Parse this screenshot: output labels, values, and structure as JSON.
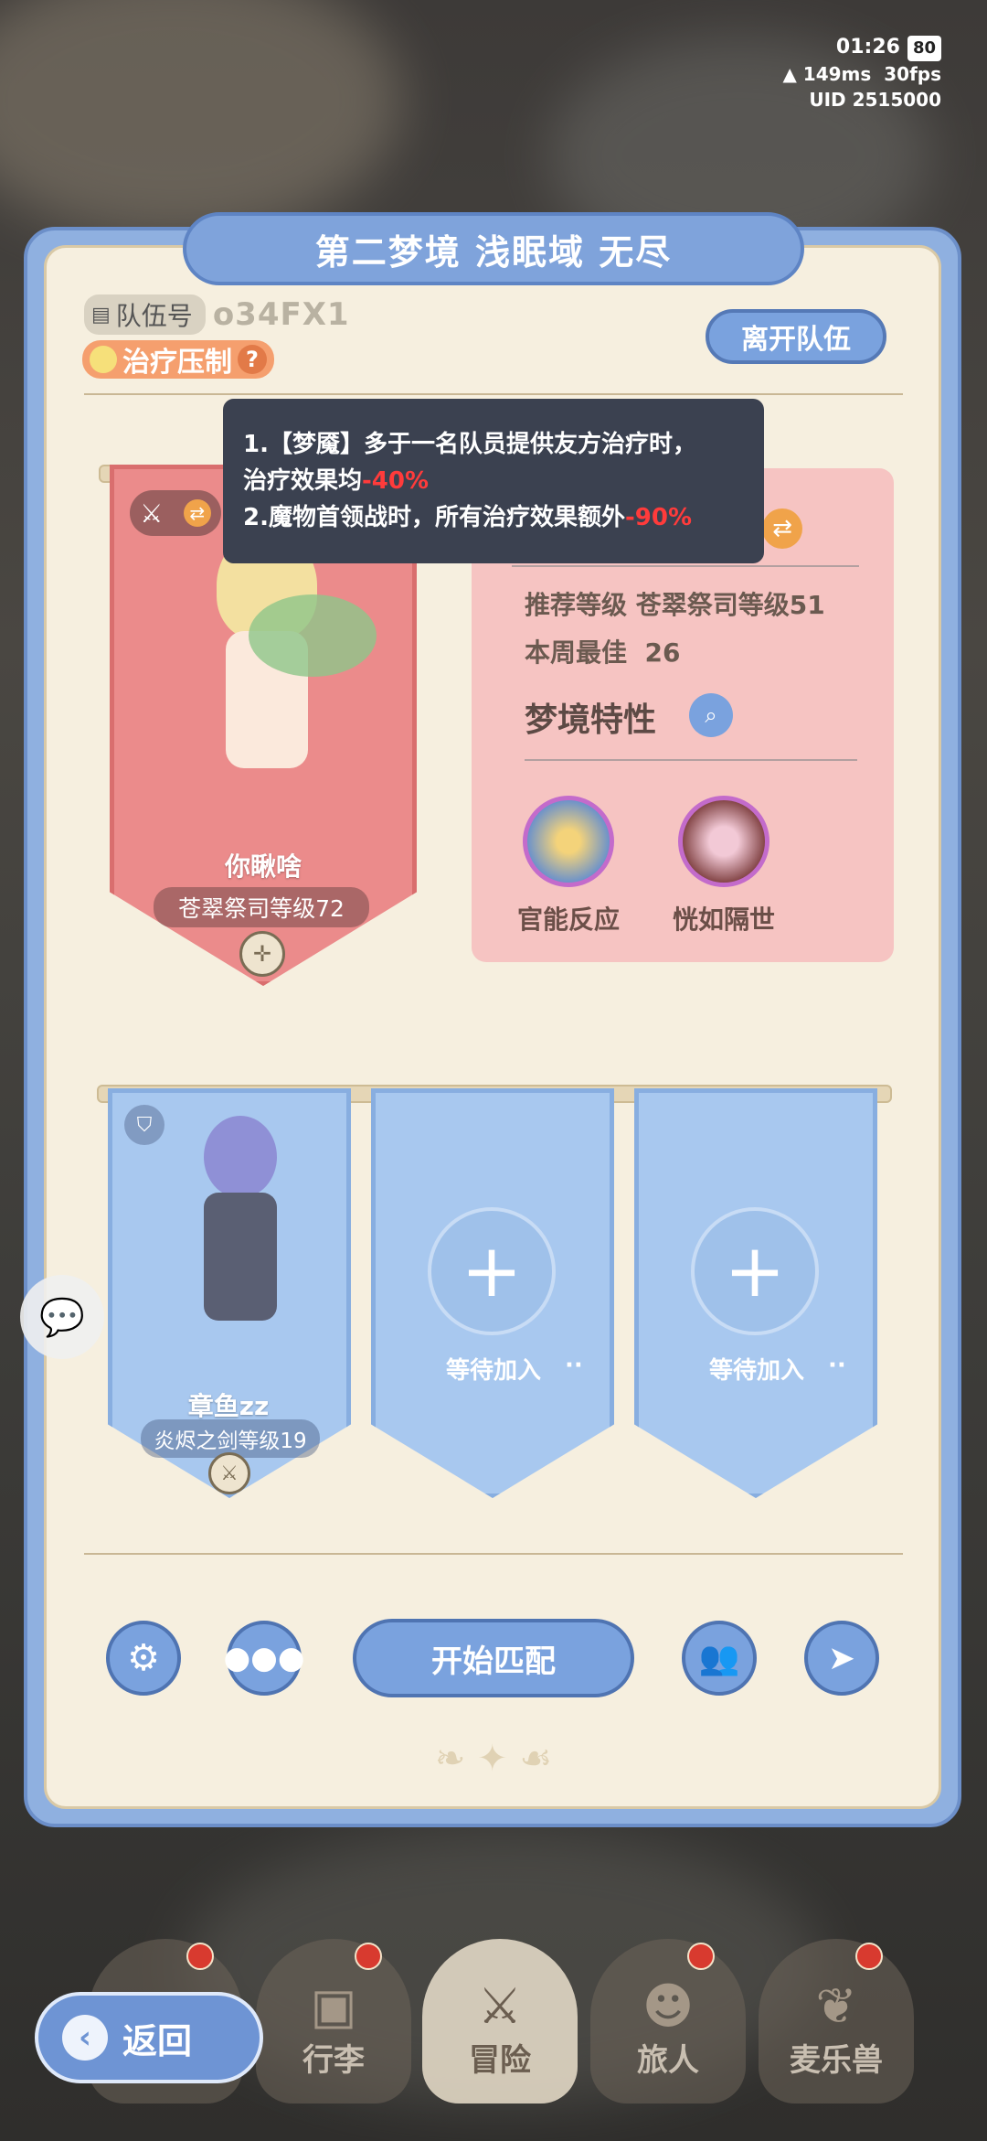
{
  "status": {
    "time": "01:26",
    "battery": "80",
    "ping": "149ms",
    "fps": "30fps",
    "uid": "UID  2515000"
  },
  "title": "第二梦境 浅眠域 无尽",
  "team": {
    "id_label": "队伍号",
    "id_value": "o34FX1",
    "heal_chip": "治疗压制",
    "leave_label": "离开队伍"
  },
  "tooltip": {
    "line1": "1.【梦魇】多于一名队员提供友方治疗时，",
    "line2_prefix": "治疗效果均",
    "line2_value": "-40%",
    "line3_prefix": "2.魔物首领战时，所有治疗效果额外",
    "line3_value": "-90%"
  },
  "leader": {
    "name": "你瞅啥",
    "level": "苍翠祭司等级72"
  },
  "info": {
    "recommend_label": "推荐等级",
    "recommend_value": "苍翠祭司等级51",
    "best_label": "本周最佳",
    "best_value": "26",
    "traits_title": "梦境特性",
    "traits": [
      {
        "label": "官能反应"
      },
      {
        "label": "恍如隔世"
      }
    ]
  },
  "members": [
    {
      "name": "章鱼zz",
      "level": "炎烬之剑等级19"
    },
    {
      "wait": "等待加入",
      "ellipsis": "··"
    },
    {
      "wait": "等待加入",
      "ellipsis": "··"
    }
  ],
  "actions": {
    "match": "开始匹配"
  },
  "nav": [
    {
      "label": ""
    },
    {
      "label": "行李"
    },
    {
      "label": "冒险"
    },
    {
      "label": "旅人"
    },
    {
      "label": "麦乐兽"
    }
  ],
  "back_label": "返回",
  "colors": {
    "accent_blue": "#7aa2de",
    "pink_banner": "#eb8b8b",
    "negative": "#ff3b3b"
  }
}
